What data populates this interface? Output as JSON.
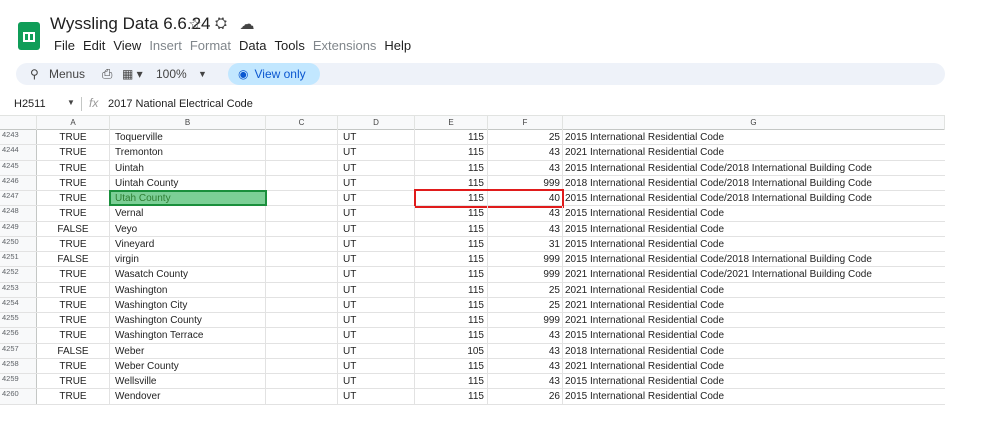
{
  "app": {
    "title": "Wyssling Data 6.6.24",
    "icons": [
      "star-icon",
      "move-to-drive-icon",
      "cloud-status-icon"
    ],
    "menu": [
      {
        "label": "File",
        "enabled": true
      },
      {
        "label": "Edit",
        "enabled": true
      },
      {
        "label": "View",
        "enabled": true
      },
      {
        "label": "Insert",
        "enabled": false
      },
      {
        "label": "Format",
        "enabled": false
      },
      {
        "label": "Data",
        "enabled": true
      },
      {
        "label": "Tools",
        "enabled": true
      },
      {
        "label": "Extensions",
        "enabled": false
      },
      {
        "label": "Help",
        "enabled": true
      }
    ]
  },
  "toolbar": {
    "search_label": "Menus",
    "zoom": "100%",
    "view_only_label": "View only"
  },
  "formula_bar": {
    "cell_ref": "H2511",
    "fx": "fx",
    "content": "2017 National Electrical Code"
  },
  "columns": [
    "A",
    "B",
    "C",
    "D",
    "E",
    "F",
    "G"
  ],
  "rows": [
    {
      "num": "4243",
      "a": "TRUE",
      "b": "Toquerville",
      "c": "",
      "d": "UT",
      "e": "115",
      "f": "25",
      "g": "2015 International Residential Code"
    },
    {
      "num": "4244",
      "a": "TRUE",
      "b": "Tremonton",
      "c": "",
      "d": "UT",
      "e": "115",
      "f": "43",
      "g": "2021 International Residential Code"
    },
    {
      "num": "4245",
      "a": "TRUE",
      "b": "Uintah",
      "c": "",
      "d": "UT",
      "e": "115",
      "f": "43",
      "g": "2015 International Residential Code/2018 International Building Code"
    },
    {
      "num": "4246",
      "a": "TRUE",
      "b": "Uintah County",
      "c": "",
      "d": "UT",
      "e": "115",
      "f": "999",
      "g": "2018 International Residential Code/2018 International Building Code"
    },
    {
      "num": "4247",
      "a": "TRUE",
      "b": "Utah County",
      "c": "",
      "d": "UT",
      "e": "115",
      "f": "40",
      "g": "2015 International Residential Code/2018 International Building Code"
    },
    {
      "num": "4248",
      "a": "TRUE",
      "b": "Vernal",
      "c": "",
      "d": "UT",
      "e": "115",
      "f": "43",
      "g": "2015 International Residential Code"
    },
    {
      "num": "4249",
      "a": "FALSE",
      "b": "Veyo",
      "c": "",
      "d": "UT",
      "e": "115",
      "f": "43",
      "g": "2015 International Residential Code"
    },
    {
      "num": "4250",
      "a": "TRUE",
      "b": "Vineyard",
      "c": "",
      "d": "UT",
      "e": "115",
      "f": "31",
      "g": "2015 International Residential Code"
    },
    {
      "num": "4251",
      "a": "FALSE",
      "b": "virgin",
      "c": "",
      "d": "UT",
      "e": "115",
      "f": "999",
      "g": "2015 International Residential Code/2018 International Building Code"
    },
    {
      "num": "4252",
      "a": "TRUE",
      "b": "Wasatch County",
      "c": "",
      "d": "UT",
      "e": "115",
      "f": "999",
      "g": "2021 International Residential Code/2021 International Building Code"
    },
    {
      "num": "4253",
      "a": "TRUE",
      "b": "Washington",
      "c": "",
      "d": "UT",
      "e": "115",
      "f": "25",
      "g": "2021 International Residential Code"
    },
    {
      "num": "4254",
      "a": "TRUE",
      "b": "Washington City",
      "c": "",
      "d": "UT",
      "e": "115",
      "f": "25",
      "g": "2021 International Residential Code"
    },
    {
      "num": "4255",
      "a": "TRUE",
      "b": "Washington County",
      "c": "",
      "d": "UT",
      "e": "115",
      "f": "999",
      "g": "2021 International Residential Code"
    },
    {
      "num": "4256",
      "a": "TRUE",
      "b": "Washington Terrace",
      "c": "",
      "d": "UT",
      "e": "115",
      "f": "43",
      "g": "2015 International Residential Code"
    },
    {
      "num": "4257",
      "a": "FALSE",
      "b": "Weber",
      "c": "",
      "d": "UT",
      "e": "105",
      "f": "43",
      "g": "2018 International Residential Code"
    },
    {
      "num": "4258",
      "a": "TRUE",
      "b": "Weber County",
      "c": "",
      "d": "UT",
      "e": "115",
      "f": "43",
      "g": "2021 International Residential Code"
    },
    {
      "num": "4259",
      "a": "TRUE",
      "b": "Wellsville",
      "c": "",
      "d": "UT",
      "e": "115",
      "f": "43",
      "g": "2015 International Residential Code"
    },
    {
      "num": "4260",
      "a": "TRUE",
      "b": "Wendover",
      "c": "",
      "d": "UT",
      "e": "115",
      "f": "26",
      "g": "2015 International Residential Code"
    }
  ],
  "selection": {
    "row_index": 4,
    "column": "B"
  },
  "highlight": {
    "row_index": 4,
    "columns": [
      "E",
      "F"
    ],
    "color": "#e01b1b"
  },
  "colors": {
    "brand": "#0f9d58",
    "view_only_chip": "#c2e7ff",
    "selected_cell": "#7ccf96"
  }
}
